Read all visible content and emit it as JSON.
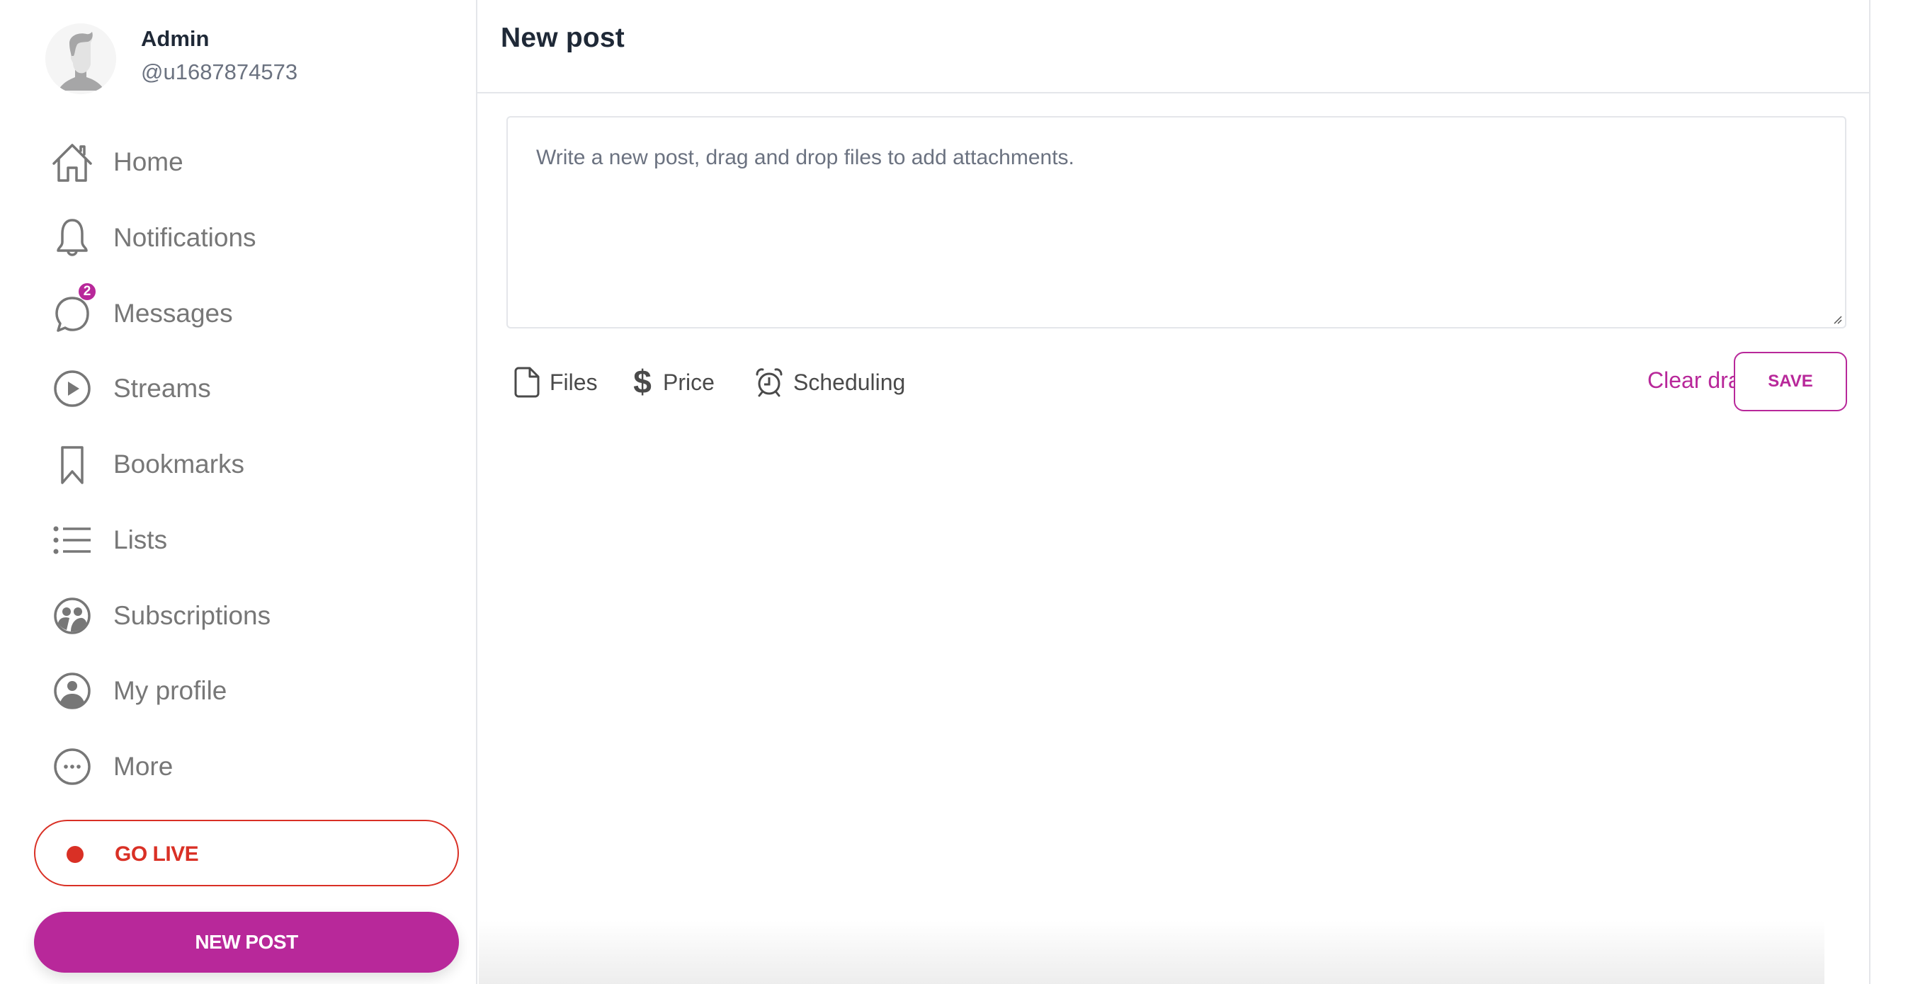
{
  "profile": {
    "name": "Admin",
    "handle": "@u1687874573"
  },
  "sidebar": {
    "items": [
      {
        "label": "Home",
        "icon": "home-icon"
      },
      {
        "label": "Notifications",
        "icon": "bell-icon"
      },
      {
        "label": "Messages",
        "icon": "chat-bubble-icon",
        "badge": "2"
      },
      {
        "label": "Streams",
        "icon": "play-circle-icon"
      },
      {
        "label": "Bookmarks",
        "icon": "bookmark-icon"
      },
      {
        "label": "Lists",
        "icon": "list-icon"
      },
      {
        "label": "Subscriptions",
        "icon": "subscriptions-icon"
      },
      {
        "label": "My profile",
        "icon": "user-circle-icon"
      },
      {
        "label": "More",
        "icon": "more-circle-icon"
      }
    ],
    "go_live_label": "GO LIVE",
    "new_post_label": "NEW POST"
  },
  "main": {
    "title": "New post",
    "composer": {
      "placeholder": "Write a new post, drag and drop files to add attachments.",
      "value": ""
    },
    "toolbar": {
      "files_label": "Files",
      "price_label": "Price",
      "scheduling_label": "Scheduling",
      "clear_draft_label": "Clear draft",
      "save_label": "SAVE"
    }
  },
  "colors": {
    "accent": "#b8289a",
    "live": "#d93025",
    "text_dark": "#1f2937",
    "text_muted": "#777777",
    "border": "#e4e6ea"
  }
}
